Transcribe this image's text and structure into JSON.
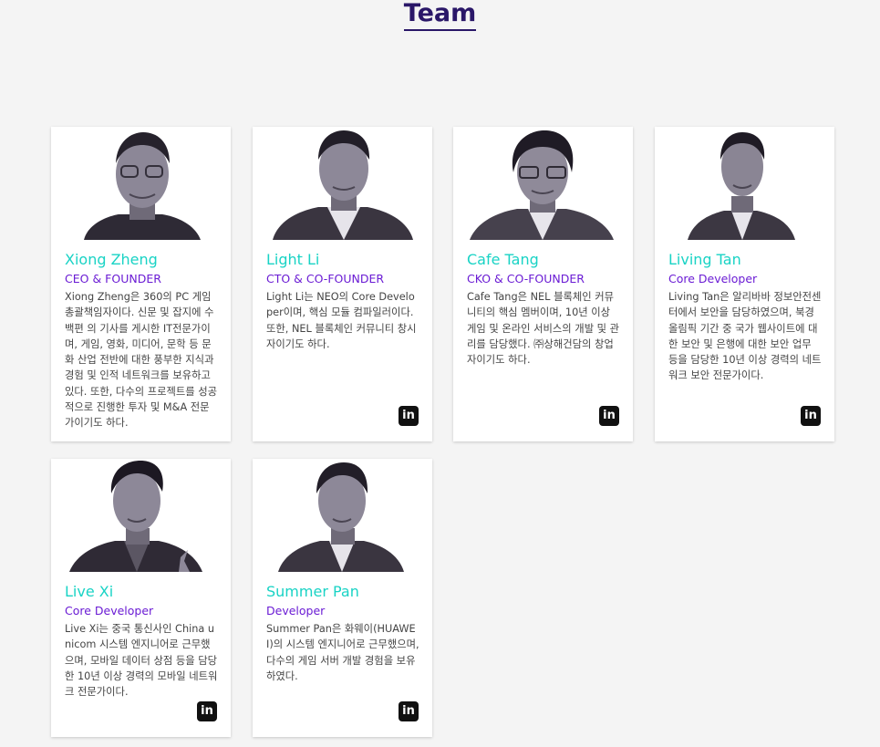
{
  "section": {
    "title": "Team"
  },
  "members": [
    {
      "name": "Xiong Zheng",
      "role": "CEO & FOUNDER",
      "bio": "Xiong Zheng은 360의 PC 게임 총괄책임자이다. 신문 및 잡지에 수백편 의 기사를 게시한 IT전문가이며, 게임, 영화, 미디어, 문학 등 문화 산업 전반에 대한 풍부한 지식과 경험 및 인적 네트워크를 보유하고 있다. 또한, 다수의 프로젝트를 성공적으로 진행한 투자 및 M&A 전문가이기도 하다.",
      "linkedin_icon": "in"
    },
    {
      "name": "Light Li",
      "role": "CTO & CO-FOUNDER",
      "bio": "Light Li는 NEO의 Core Developer이며, 핵심 모듈 컴파일러이다. 또한, NEL 블록체인 커뮤니티 창시자이기도 하다.",
      "linkedin_icon": "in"
    },
    {
      "name": "Cafe Tang",
      "role": "CKO & CO-FOUNDER",
      "bio": "Cafe Tang은 NEL 블록체인 커뮤니티의 핵심 멤버이며, 10년 이상 게임 및 온라인 서비스의 개발 및 관리를 담당했다. ㈜상해건담의 창업자이기도 하다.",
      "linkedin_icon": "in"
    },
    {
      "name": "Living Tan",
      "role": "Core Developer",
      "bio": "Living Tan은 알리바바 정보안전센터에서 보안을 담당하였으며, 북경 올림픽 기간 중 국가 웹사이트에 대한 보안 및 은행에 대한 보안 업무 등을 담당한 10년 이상 경력의 네트워크 보안 전문가이다.",
      "linkedin_icon": "in"
    },
    {
      "name": "Live Xi",
      "role": "Core Developer",
      "bio": "Live Xi는 중국 통신사인 China unicom 시스템 엔지니어로 근무했으며, 모바일 데이터 상점 등을 담당한 10년 이상 경력의 모바일 네트워크 전문가이다.",
      "linkedin_icon": "in"
    },
    {
      "name": "Summer Pan",
      "role": "Developer",
      "bio": "Summer Pan은 화웨이(HUAWEI)의 시스템 엔지니어로 근무했으며, 다수의 게임 서버 개발 경험을 보유하였다.",
      "linkedin_icon": "in"
    }
  ],
  "colors": {
    "title": "#2a1768",
    "name": "#19d3c5",
    "role": "#6a1bd4"
  }
}
